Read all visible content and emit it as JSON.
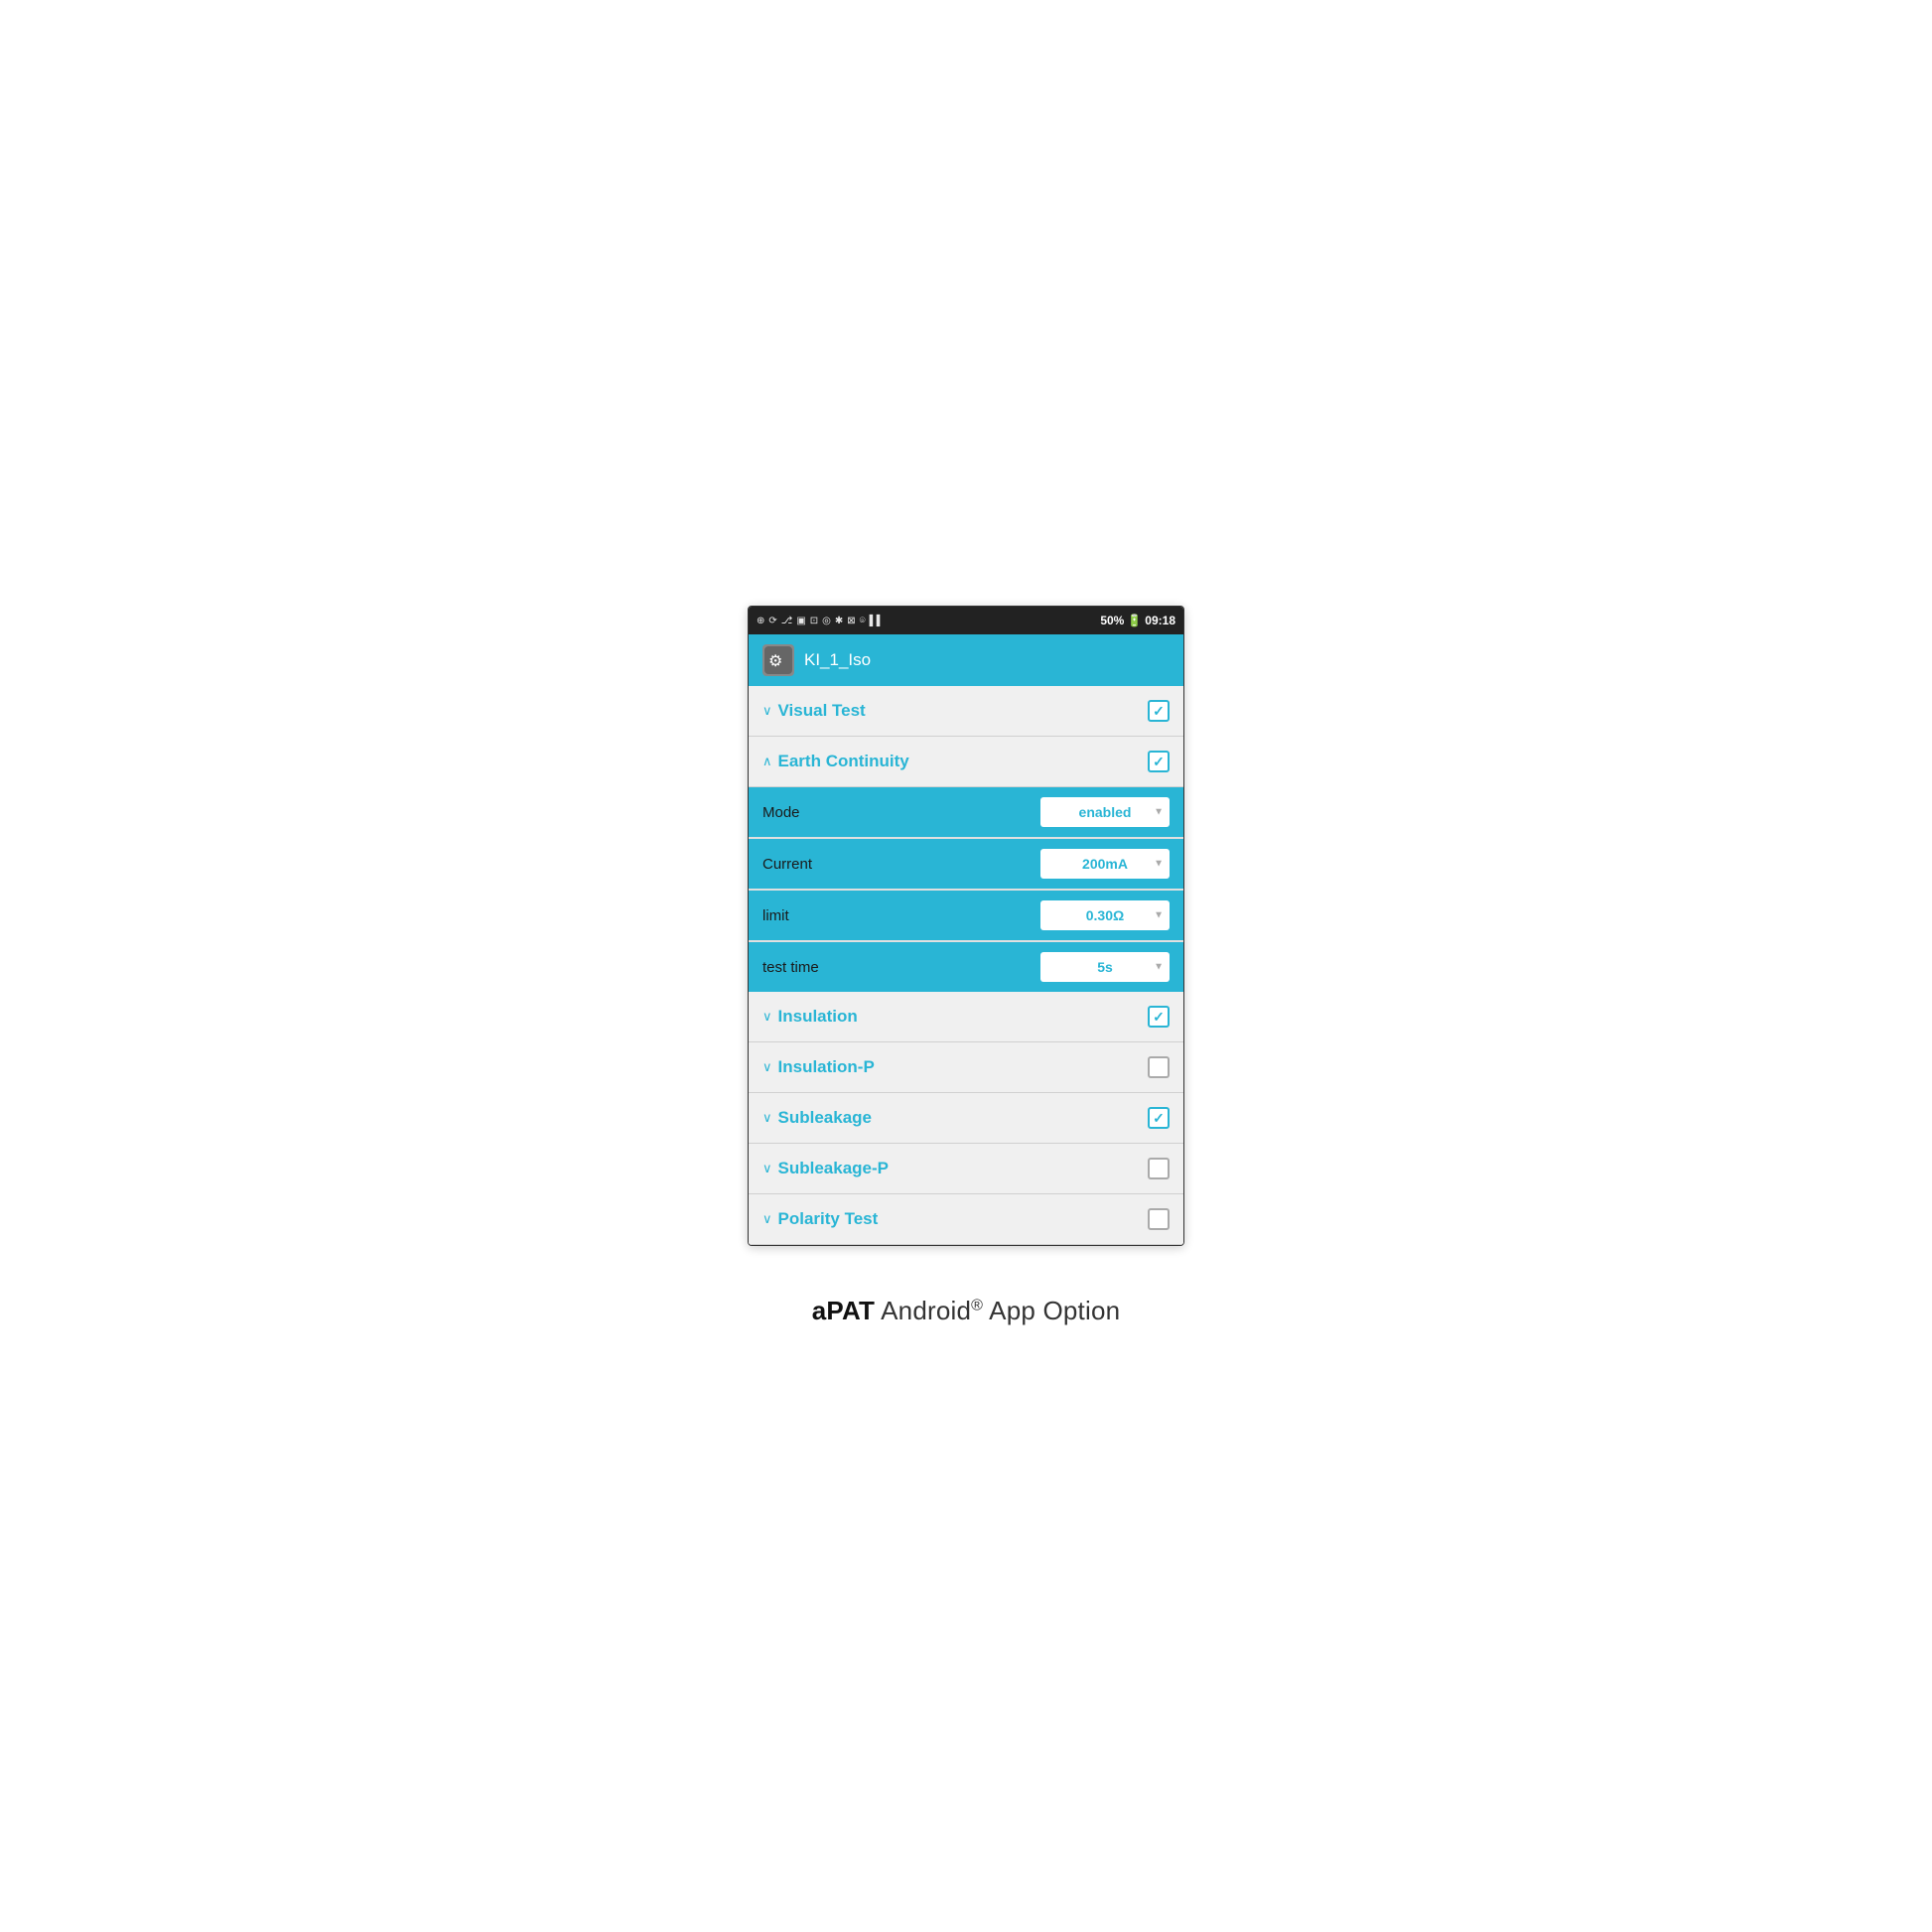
{
  "statusBar": {
    "time": "09:18",
    "battery": "50%",
    "icons": [
      "⊕",
      "⟳",
      "⎇",
      "▣",
      "⊡",
      "👁",
      "✱",
      "⊠",
      "📶",
      "▌"
    ]
  },
  "header": {
    "appName": "KI_1_Iso",
    "iconLabel": "app-icon"
  },
  "sections": [
    {
      "id": "visual-test",
      "title": "Visual Test",
      "chevron": "∨",
      "checked": true,
      "expanded": false,
      "fields": []
    },
    {
      "id": "earth-continuity",
      "title": "Earth Continuity",
      "chevron": "∧",
      "checked": true,
      "expanded": true,
      "fields": [
        {
          "label": "Mode",
          "value": "enabled"
        },
        {
          "label": "Current",
          "value": "200mA"
        },
        {
          "label": "limit",
          "value": "0.30Ω"
        },
        {
          "label": "test time",
          "value": "5s"
        }
      ]
    },
    {
      "id": "insulation",
      "title": "Insulation",
      "chevron": "∨",
      "checked": true,
      "expanded": false,
      "fields": []
    },
    {
      "id": "insulation-p",
      "title": "Insulation-P",
      "chevron": "∨",
      "checked": false,
      "expanded": false,
      "fields": []
    },
    {
      "id": "subleakage",
      "title": "Subleakage",
      "chevron": "∨",
      "checked": true,
      "expanded": false,
      "fields": []
    },
    {
      "id": "subleakage-p",
      "title": "Subleakage-P",
      "chevron": "∨",
      "checked": false,
      "expanded": false,
      "fields": []
    },
    {
      "id": "polarity-test",
      "title": "Polarity Test",
      "chevron": "∨",
      "checked": false,
      "expanded": false,
      "fields": []
    }
  ],
  "caption": {
    "bold": "aPAT",
    "normal": " Android",
    "superscript": "®",
    "end": " App Option"
  }
}
